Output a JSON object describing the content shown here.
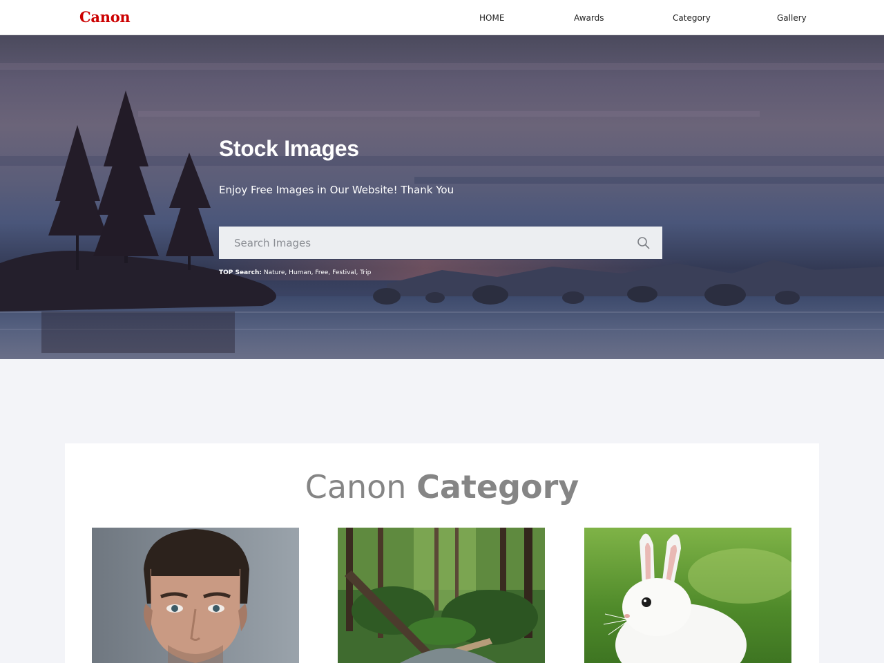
{
  "brand": {
    "logo_text": "Canon",
    "logo_color": "#cc0000"
  },
  "nav": {
    "items": [
      {
        "label": "HOME"
      },
      {
        "label": "Awards"
      },
      {
        "label": "Category"
      },
      {
        "label": "Gallery"
      }
    ]
  },
  "hero": {
    "title": "Stock Images",
    "subtitle": "Enjoy Free Images in Our Website! Thank You",
    "search": {
      "placeholder": "Search Images",
      "value": "",
      "icon": "search-icon"
    },
    "top_search": {
      "label": "TOP Search:",
      "tags": [
        "Nature",
        "Human",
        "Free",
        "Festival",
        "Trip"
      ],
      "separator": ", "
    }
  },
  "category_section": {
    "title_light": "Canon",
    "title_bold": "Category",
    "cards": [
      {
        "image": "man-portrait"
      },
      {
        "image": "forest-stream"
      },
      {
        "image": "white-rabbit"
      }
    ]
  },
  "colors": {
    "header_bg": "#ffffff",
    "page_bg": "#f3f4f8",
    "panel_bg": "#ffffff",
    "heading_gray": "#858585",
    "search_bg": "#eceef1"
  }
}
